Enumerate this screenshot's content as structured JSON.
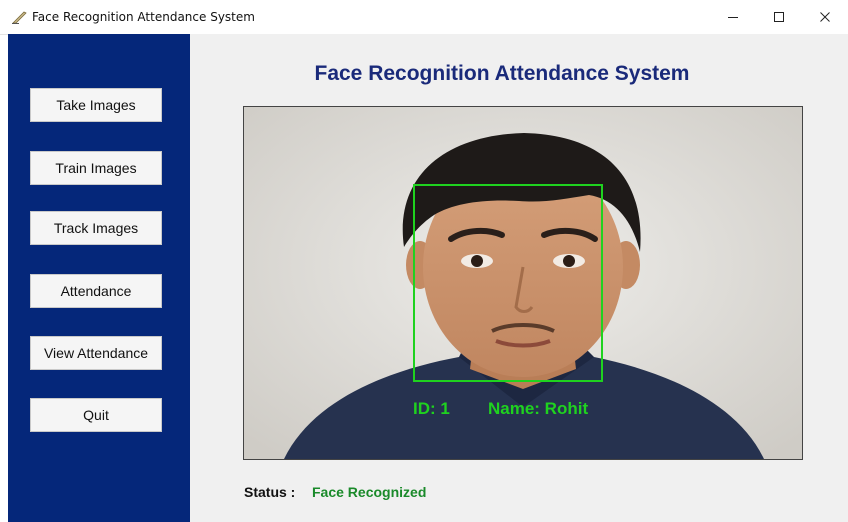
{
  "window": {
    "title": "Face Recognition Attendance System",
    "minimize_symbol": "–",
    "maximize_symbol": "☐",
    "close_symbol": "✕"
  },
  "sidebar": {
    "buttons": [
      {
        "label": "Take Images"
      },
      {
        "label": "Train Images"
      },
      {
        "label": "Track Images"
      },
      {
        "label": "Attendance"
      },
      {
        "label": "View Attendance"
      },
      {
        "label": "Quit"
      }
    ]
  },
  "main": {
    "heading": "Face Recognition Attendance System",
    "camera": {
      "id_text": "ID: 1",
      "name_text": "Name: Rohit"
    },
    "status": {
      "label": "Status :",
      "value": "Face Recognized"
    }
  },
  "colors": {
    "sidebar_bg": "#05277a",
    "heading": "#1a2a7a",
    "detection_box": "#1fd21f",
    "status_ok": "#1a8a2a"
  },
  "icons": {
    "app": "feather-pen-icon",
    "person": "person-photo"
  }
}
